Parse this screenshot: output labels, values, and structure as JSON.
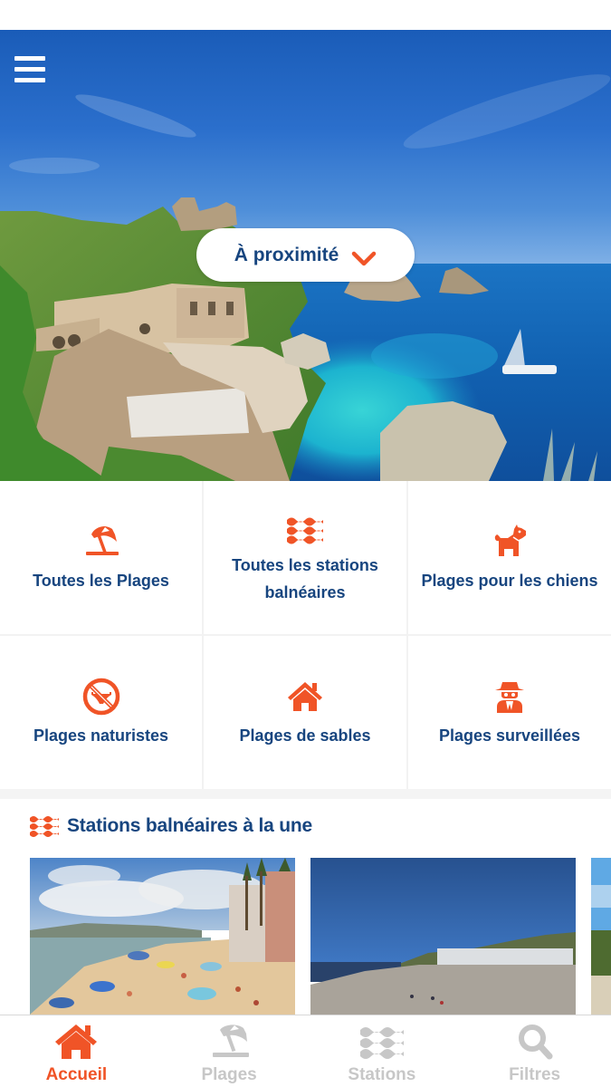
{
  "colors": {
    "accent": "#f05427",
    "primary_text": "#17457f",
    "inactive_tab": "#c7c7c7",
    "divider": "#f2f2f2"
  },
  "hero": {
    "menu_icon": "hamburger-menu-icon",
    "location_selector": {
      "label": "À proximité",
      "icon": "chevron-down-icon"
    }
  },
  "categories": [
    {
      "label": "Toutes les Plages",
      "icon": "beach-umbrella-icon"
    },
    {
      "label": "Toutes les stations balnéaires",
      "icon": "water-waves-icon"
    },
    {
      "label": "Plages pour les chiens",
      "icon": "dog-icon"
    },
    {
      "label": "Plages naturistes",
      "icon": "no-swimsuit-icon"
    },
    {
      "label": "Plages de sables",
      "icon": "home-icon"
    },
    {
      "label": "Plages surveillées",
      "icon": "spy-icon"
    }
  ],
  "featured": {
    "title": "Stations balnéaires à la une",
    "icon": "water-waves-icon",
    "cards": [
      {
        "image": "crowded-beach-with-palms-photo"
      },
      {
        "image": "wide-sandy-beach-blue-sky-photo"
      },
      {
        "image": "beach-with-trees-photo"
      }
    ]
  },
  "tabbar": {
    "tabs": [
      {
        "label": "Accueil",
        "icon": "home-icon",
        "active": true
      },
      {
        "label": "Plages",
        "icon": "beach-umbrella-icon",
        "active": false
      },
      {
        "label": "Stations",
        "icon": "water-waves-icon",
        "active": false
      },
      {
        "label": "Filtres",
        "icon": "search-icon",
        "active": false
      }
    ]
  }
}
